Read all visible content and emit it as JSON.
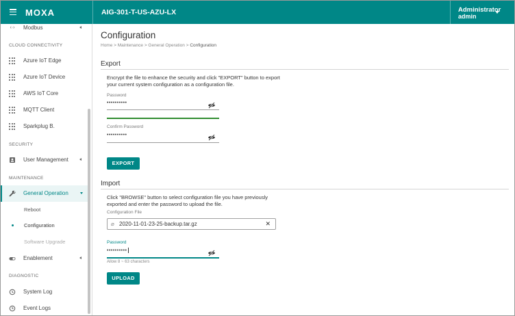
{
  "header": {
    "logo": "MOXA",
    "device_name": "AIG-301-T-US-AZU-LX",
    "user_role": "Administrator",
    "user_name": "admin"
  },
  "sidebar": {
    "top_item": {
      "label": "Modbus",
      "icon": "code-brackets-icon"
    },
    "sections": {
      "cloud": "CLOUD CONNECTIVITY",
      "security": "SECURITY",
      "maintenance": "MAINTENANCE",
      "diagnostic": "DIAGNOSTIC"
    },
    "cloud_items": [
      {
        "label": "Azure IoT Edge",
        "icon": "grid-icon"
      },
      {
        "label": "Azure IoT Device",
        "icon": "grid-icon"
      },
      {
        "label": "AWS IoT Core",
        "icon": "grid-icon"
      },
      {
        "label": "MQTT Client",
        "icon": "grid-icon"
      },
      {
        "label": "Sparkplug B.",
        "icon": "grid-icon"
      }
    ],
    "user_management": {
      "label": "User Management",
      "icon": "user-card-icon"
    },
    "general_operation": {
      "label": "General Operation",
      "icon": "wrench-icon"
    },
    "sub_items": [
      {
        "label": "Reboot"
      },
      {
        "label": "Configuration"
      },
      {
        "label": "Software Upgrade"
      }
    ],
    "enablement": {
      "label": "Enablement",
      "icon": "toggle-icon"
    },
    "system_log": {
      "label": "System Log",
      "icon": "history-icon"
    },
    "event_logs": {
      "label": "Event Logs",
      "icon": "clock-icon"
    }
  },
  "main": {
    "title": "Configuration",
    "breadcrumb": [
      "Home",
      "Maintenance",
      "General Operation",
      "Configuration"
    ],
    "breadcrumb_sep": ">",
    "export": {
      "title": "Export",
      "description": "Encrypt the file to enhance the security and click \"EXPORT\" button to export your current system configuration as a configuration file.",
      "password_label": "Password",
      "password_value": "••••••••••",
      "confirm_label": "Confirm Password",
      "confirm_value": "••••••••••",
      "button": "EXPORT"
    },
    "import": {
      "title": "Import",
      "description": "Click \"BROWSE\" button to select configuration file you have previously exported and enter the password to upload the file.",
      "file_label": "Configuration File",
      "file_name": "2020-11-01-23-25-backup.tar.gz",
      "clear_glyph": "✕",
      "password_label": "Password",
      "password_value": "••••••••••",
      "helper": "Allow 8 ~ 63 characters",
      "button": "UPLOAD"
    }
  },
  "colors": {
    "accent": "#008787",
    "strength": "#2e8b2e"
  }
}
